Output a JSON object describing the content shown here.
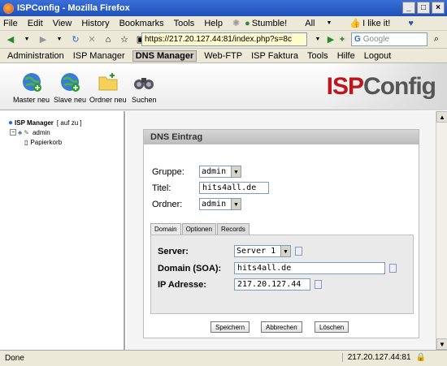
{
  "window": {
    "title": "ISPConfig - Mozilla Firefox"
  },
  "menubar": {
    "items": [
      "File",
      "Edit",
      "View",
      "History",
      "Bookmarks",
      "Tools",
      "Help"
    ],
    "stumble": "Stumble!",
    "all": "All",
    "like": "I like it!"
  },
  "nav": {
    "url": "https://217.20.127.44:81/index.php?s=8c",
    "search_placeholder": "Google"
  },
  "appmenu": {
    "items": [
      "Administration",
      "ISP Manager",
      "DNS Manager",
      "Web-FTP",
      "ISP Faktura",
      "Tools",
      "Hilfe",
      "Logout"
    ],
    "active_index": 2
  },
  "toolbar": {
    "buttons": [
      "Master neu",
      "Slave neu",
      "Ordner neu",
      "Suchen"
    ],
    "logo_isp": "ISP",
    "logo_config": "Config"
  },
  "tree": {
    "root": "ISP Manager",
    "links": "[ auf  zu ]",
    "child": "admin",
    "grandchild": "Papierkorb"
  },
  "panel": {
    "title": "DNS Eintrag",
    "gruppe_label": "Gruppe:",
    "gruppe_value": "admin",
    "titel_label": "Titel:",
    "titel_value": "hits4all.de",
    "ordner_label": "Ordner:",
    "ordner_value": "admin",
    "tabs": [
      "Domain",
      "Optionen",
      "Records"
    ],
    "server_label": "Server:",
    "server_value": "Server 1",
    "domain_label": "Domain (SOA):",
    "domain_value": "hits4all.de",
    "ip_label": "IP Adresse:",
    "ip_value": "217.20.127.44",
    "buttons": [
      "Speichern",
      "Abbrechen",
      "Löschen"
    ]
  },
  "status": {
    "text": "Done",
    "ip": "217.20.127.44:81"
  }
}
